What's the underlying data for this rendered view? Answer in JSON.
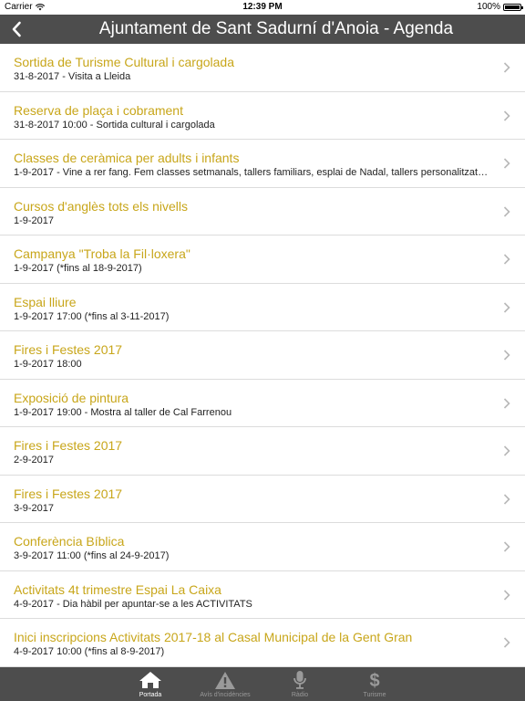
{
  "status_bar": {
    "carrier": "Carrier",
    "time": "12:39 PM",
    "battery": "100%",
    "battery_level": 1.0
  },
  "nav": {
    "title": "Ajuntament de Sant Sadurní d'Anoia - Agenda",
    "back_icon": "chevron-left-icon"
  },
  "events": [
    {
      "title": "Sortida de Turisme Cultural i  cargolada",
      "subtitle": "31-8-2017 - Visita a Lleida"
    },
    {
      "title": "Reserva de plaça i cobrament",
      "subtitle": "31-8-2017 10:00 - Sortida cultural i cargolada"
    },
    {
      "title": "Classes de ceràmica per adults i infants",
      "subtitle": "1-9-2017 - Vine a rer fang. Fem classes setmanals, tallers familiars, esplai de Nadal, tallers personalitzat…"
    },
    {
      "title": "Cursos d'anglès tots els nivells",
      "subtitle": "1-9-2017"
    },
    {
      "title": "Campanya \"Troba la Fil·loxera\"",
      "subtitle": "1-9-2017 (*fins al 18-9-2017)"
    },
    {
      "title": "Espai lliure",
      "subtitle": "1-9-2017 17:00 (*fins al 3-11-2017)"
    },
    {
      "title": "Fires i Festes 2017",
      "subtitle": "1-9-2017 18:00"
    },
    {
      "title": "Exposició de pintura",
      "subtitle": "1-9-2017 19:00 - Mostra al taller de Cal Farrenou"
    },
    {
      "title": "Fires i Festes 2017",
      "subtitle": "2-9-2017"
    },
    {
      "title": "Fires i Festes 2017",
      "subtitle": "3-9-2017"
    },
    {
      "title": "Conferència Bíblica",
      "subtitle": "3-9-2017 11:00 (*fins al 24-9-2017)"
    },
    {
      "title": "Activitats 4t trimestre Espai La Caixa",
      "subtitle": "4-9-2017 - Dia hàbil per apuntar-se a les ACTIVITATS"
    },
    {
      "title": "Inici inscripcions Activitats 2017-18 al Casal Municipal de la Gent Gran",
      "subtitle": "4-9-2017 10:00 (*fins al 8-9-2017)"
    }
  ],
  "tabs": [
    {
      "label": "Portada",
      "icon": "home-icon",
      "active": true
    },
    {
      "label": "Avís d'incidències",
      "icon": "warning-icon",
      "active": false
    },
    {
      "label": "Ràdio",
      "icon": "microphone-icon",
      "active": false
    },
    {
      "label": "Turisme",
      "icon": "dollar-icon",
      "active": false
    }
  ],
  "colors": {
    "accent": "#c8a61a",
    "bar_background": "#4d4d4d",
    "tab_inactive": "#9a9a9a"
  }
}
